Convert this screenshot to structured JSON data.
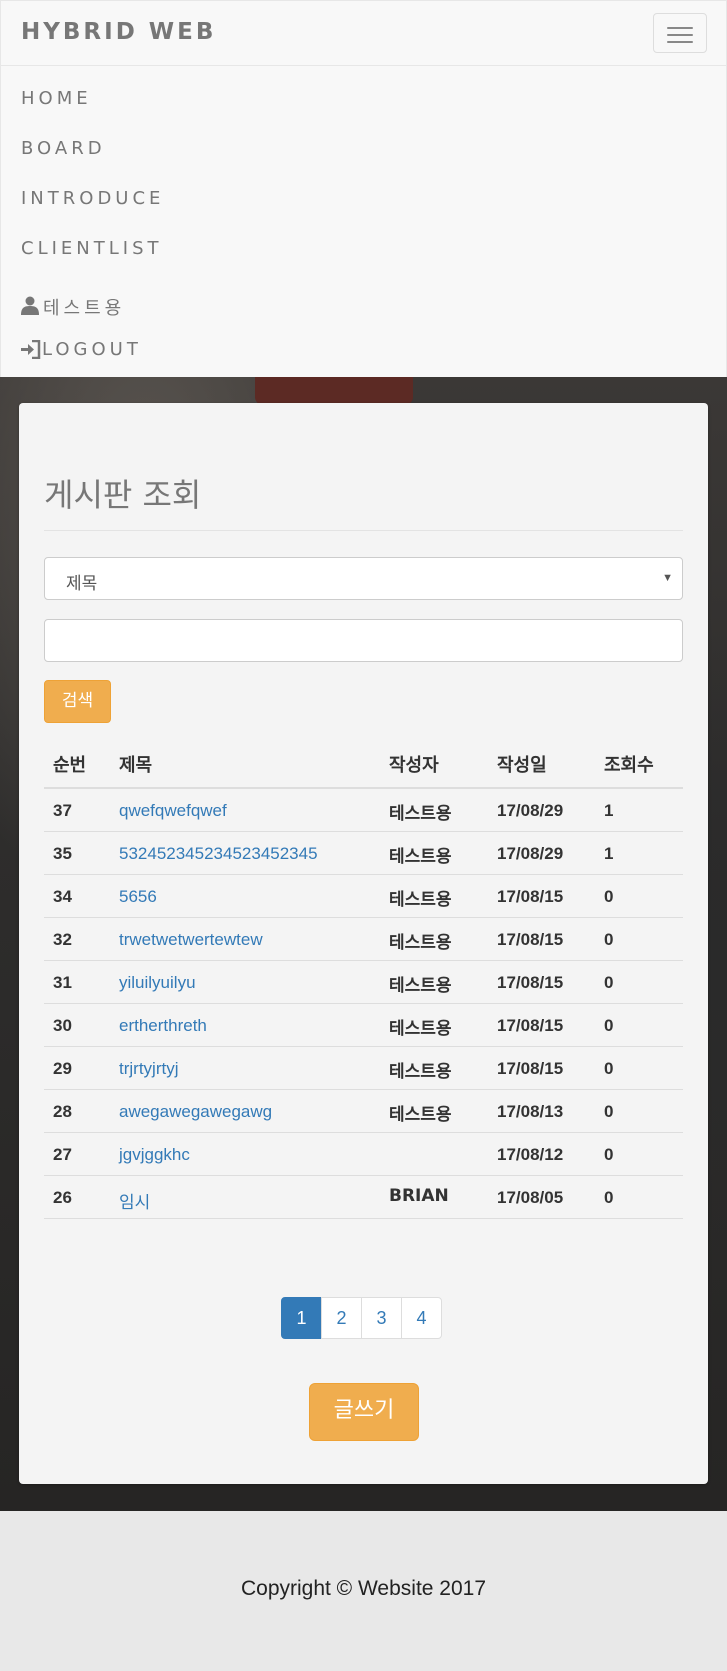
{
  "navbar": {
    "brand": "HYBRID WEB",
    "menu": [
      "HOME",
      "BOARD",
      "INTRODUCE",
      "CLIENTLIST"
    ],
    "user_label": "테스트용",
    "logout_label": "LOGOUT"
  },
  "board": {
    "title": "게시판 조회",
    "search_field_selected": "제목",
    "search_value": "",
    "search_button": "검색",
    "columns": [
      "순번",
      "제목",
      "작성자",
      "작성일",
      "조회수"
    ],
    "rows": [
      {
        "no": "37",
        "title": "qwefqwefqwef",
        "author": "테스트용",
        "date": "17/08/29",
        "views": "1"
      },
      {
        "no": "35",
        "title": "53245234523452345234​5",
        "author": "테스트용",
        "date": "17/08/29",
        "views": "1"
      },
      {
        "no": "34",
        "title": "5656",
        "author": "테스트용",
        "date": "17/08/15",
        "views": "0"
      },
      {
        "no": "32",
        "title": "trwetwetwertewtew",
        "author": "테스트용",
        "date": "17/08/15",
        "views": "0"
      },
      {
        "no": "31",
        "title": "yiluilyuilyu",
        "author": "테스트용",
        "date": "17/08/15",
        "views": "0"
      },
      {
        "no": "30",
        "title": "ertherthreth",
        "author": "테스트용",
        "date": "17/08/15",
        "views": "0"
      },
      {
        "no": "29",
        "title": "trjrtyjrtyj",
        "author": "테스트용",
        "date": "17/08/15",
        "views": "0"
      },
      {
        "no": "28",
        "title": "awegawegawegawg",
        "author": "테스트용",
        "date": "17/08/13",
        "views": "0"
      },
      {
        "no": "27",
        "title": "jgvjggkhc",
        "author": "",
        "date": "17/08/12",
        "views": "0"
      },
      {
        "no": "26",
        "title": "임시",
        "author": "BRIAN",
        "date": "17/08/05",
        "views": "0"
      }
    ],
    "pagination": [
      "1",
      "2",
      "3",
      "4"
    ],
    "active_page": "1",
    "write_button": "글쓰기"
  },
  "footer": {
    "copyright": "Copyright © Website 2017"
  }
}
